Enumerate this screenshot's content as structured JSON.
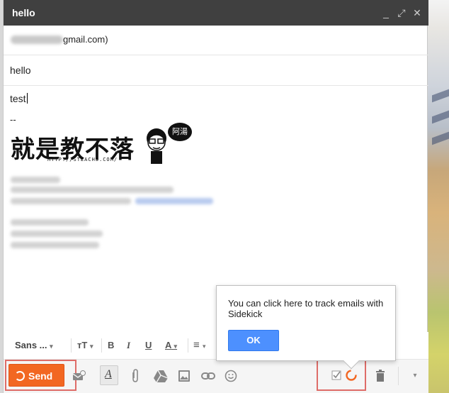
{
  "compose": {
    "title": "hello",
    "controls": {
      "minimize": "_",
      "popout": "⤢",
      "close": "✕"
    },
    "recipient_visible": "gmail.com)",
    "subject": "hello",
    "body_first_line": "test",
    "signature_dash": "--",
    "signature": {
      "logo_text": "就是教不落",
      "url": "HTTP://STEACHS.COM/",
      "bubble": "阿湯"
    }
  },
  "format_toolbar": {
    "font": "Sans ...",
    "size_label": "тT",
    "bold": "B",
    "italic": "I",
    "underline": "U",
    "text_color": "A",
    "align": "≡"
  },
  "actions": {
    "send_label": "Send"
  },
  "tooltip": {
    "message": "You can click here to track emails with Sidekick",
    "ok_label": "OK"
  },
  "colors": {
    "send": "#f26722",
    "ok": "#4d90fe",
    "highlight": "#d9534f",
    "titlebar": "#404040"
  }
}
